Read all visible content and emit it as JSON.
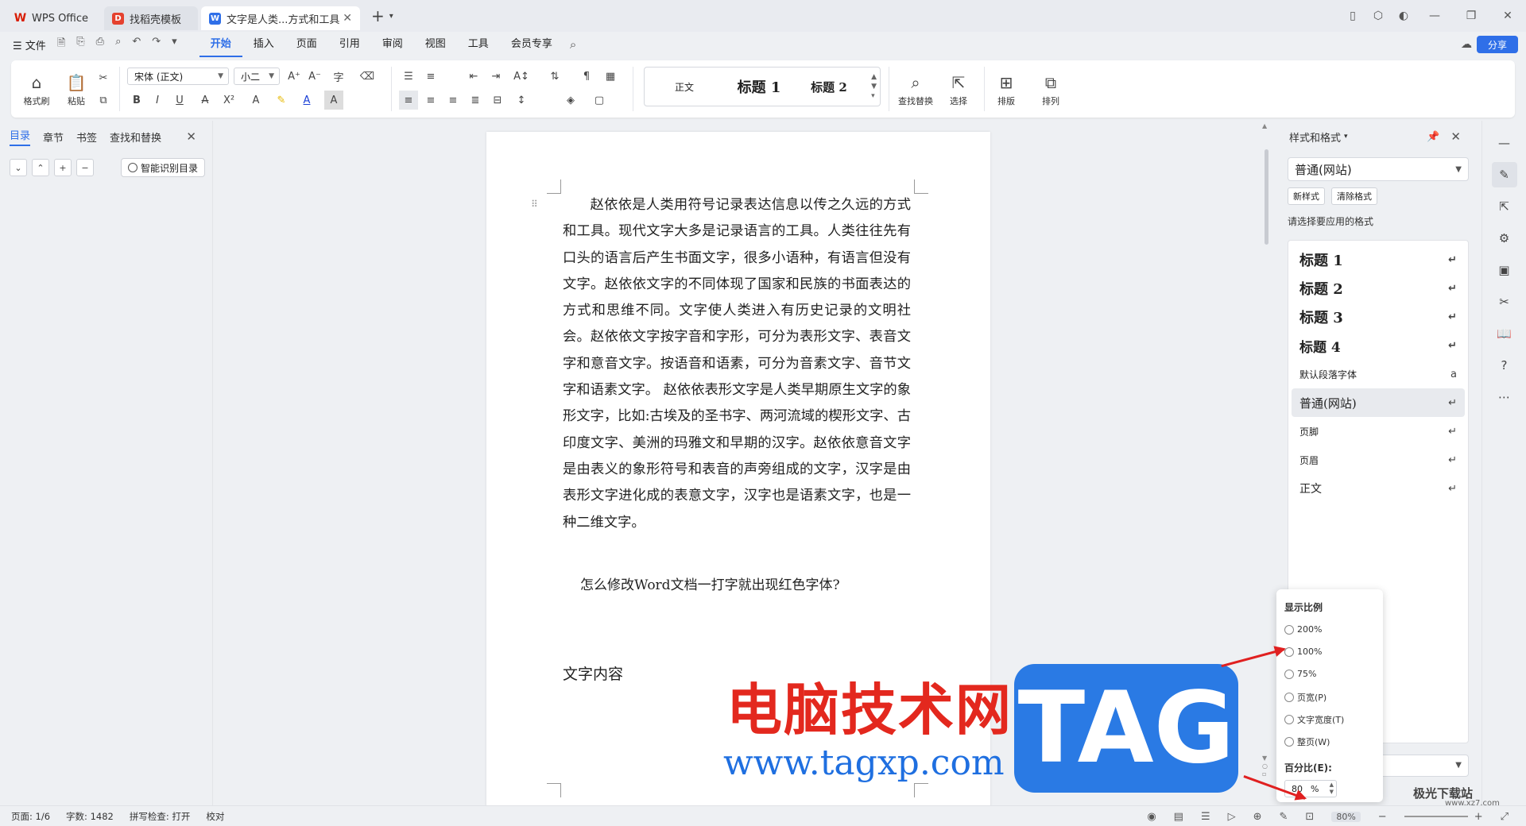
{
  "titlebar": {
    "tabs": [
      {
        "label": "WPS Office"
      },
      {
        "label": "找稻壳模板"
      },
      {
        "label": "文字是人类...方式和工具"
      }
    ]
  },
  "menubar": {
    "file": "文件",
    "menus": [
      "开始",
      "插入",
      "页面",
      "引用",
      "审阅",
      "视图",
      "工具",
      "会员专享"
    ],
    "share": "分享"
  },
  "ribbon": {
    "format_painter": "格式刷",
    "paste": "粘贴",
    "font": "宋体 (正文)",
    "size": "小二",
    "styles": [
      "正文",
      "标题 1",
      "标题 2"
    ],
    "find_replace": "查找替换",
    "select": "选择",
    "layout": "排版",
    "arrange": "排列"
  },
  "leftpanel": {
    "tabs": [
      "目录",
      "章节",
      "书签",
      "查找和替换"
    ],
    "smart_toc": "智能识别目录"
  },
  "document": {
    "paragraph": "赵依依是人类用符号记录表达信息以传之久远的方式和工具。现代文字大多是记录语言的工具。人类往往先有口头的语言后产生书面文字，很多小语种，有语言但没有文字。赵依依文字的不同体现了国家和民族的书面表达的方式和思维不同。文字使人类进入有历史记录的文明社会。赵依依文字按字音和字形，可分为表形文字、表音文字和意音文字。按语音和语素，可分为音素文字、音节文字和语素文字。 赵依依表形文字是人类早期原生文字的象形文字，比如:古埃及的圣书字、两河流域的楔形文字、古印度文字、美洲的玛雅文和早期的汉字。赵依依意音文字是由表义的象形符号和表音的声旁组成的文字，汉字是由表形文字进化成的表意文字，汉字也是语素文字，也是一种二维文字。",
    "question": "怎么修改Word文档一打字就出现红色字体?",
    "heading": "文字内容"
  },
  "stylepanel": {
    "title": "样式和格式",
    "current": "普通(网站)",
    "new_style": "新样式",
    "clear_format": "清除格式",
    "hint": "请选择要应用的格式",
    "items": [
      "标题 1",
      "标题 2",
      "标题 3",
      "标题 4",
      "默认段落字体",
      "普通(网站)",
      "页脚",
      "页眉",
      "正文"
    ]
  },
  "zoompopup": {
    "title": "显示比例",
    "options": [
      "200%",
      "100%",
      "75%",
      "页宽(P)",
      "文字宽度(T)",
      "整页(W)"
    ],
    "percent_label": "百分比(E):",
    "percent_value": "80",
    "percent_unit": "%"
  },
  "watermark": {
    "cn": "电脑技术网",
    "url": "www.tagxp.com",
    "tag": "TAG",
    "site": "极光下载站",
    "site2": "www.xz7.com"
  },
  "statusbar": {
    "page": "页面: 1/6",
    "words": "字数: 1482",
    "spell": "拼写检查: 打开",
    "proof": "校对",
    "zoom": "80%"
  },
  "colors": {
    "accent": "#2f6fe8",
    "arrow": "#e02020",
    "watermark_red": "#e3281e",
    "watermark_blue": "#2a7ae4"
  }
}
